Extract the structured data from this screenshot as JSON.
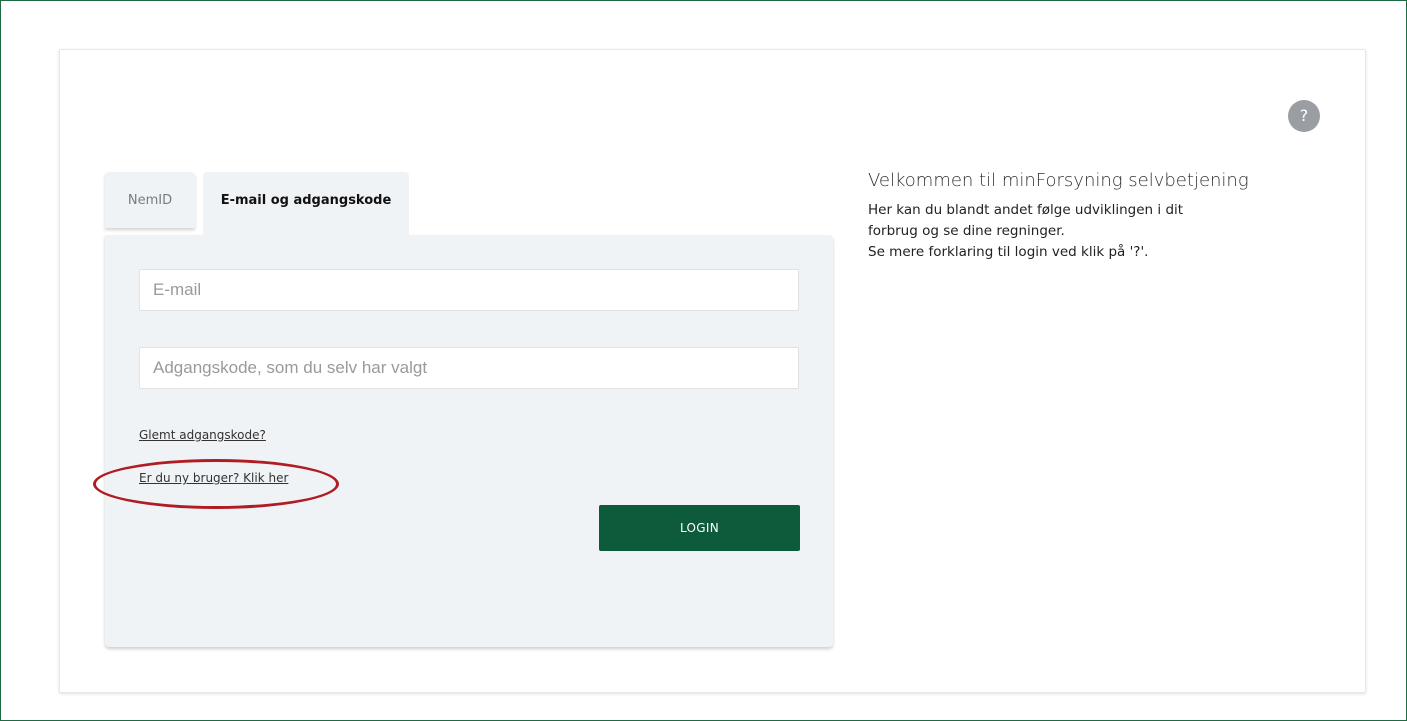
{
  "help": {
    "label": "?"
  },
  "tabs": {
    "nemid": "NemID",
    "email": "E-mail og adgangskode"
  },
  "form": {
    "email_placeholder": "E-mail",
    "email_value": "",
    "password_placeholder": "Adgangskode, som du selv har valgt",
    "password_value": "",
    "forgot_link": "Glemt adgangskode?",
    "new_user_link": "Er du ny bruger? Klik her",
    "login_button": "LOGIN"
  },
  "welcome": {
    "title": "Velkommen til minForsyning selvbetjening",
    "lines": [
      "Her kan du blandt andet følge udviklingen i dit",
      "forbrug og se dine regninger.",
      "Se mere forklaring til login ved klik på '?'."
    ]
  },
  "colors": {
    "accent": "#0e5b3c",
    "annotation": "#b01c24",
    "panel": "#f0f3f5"
  }
}
